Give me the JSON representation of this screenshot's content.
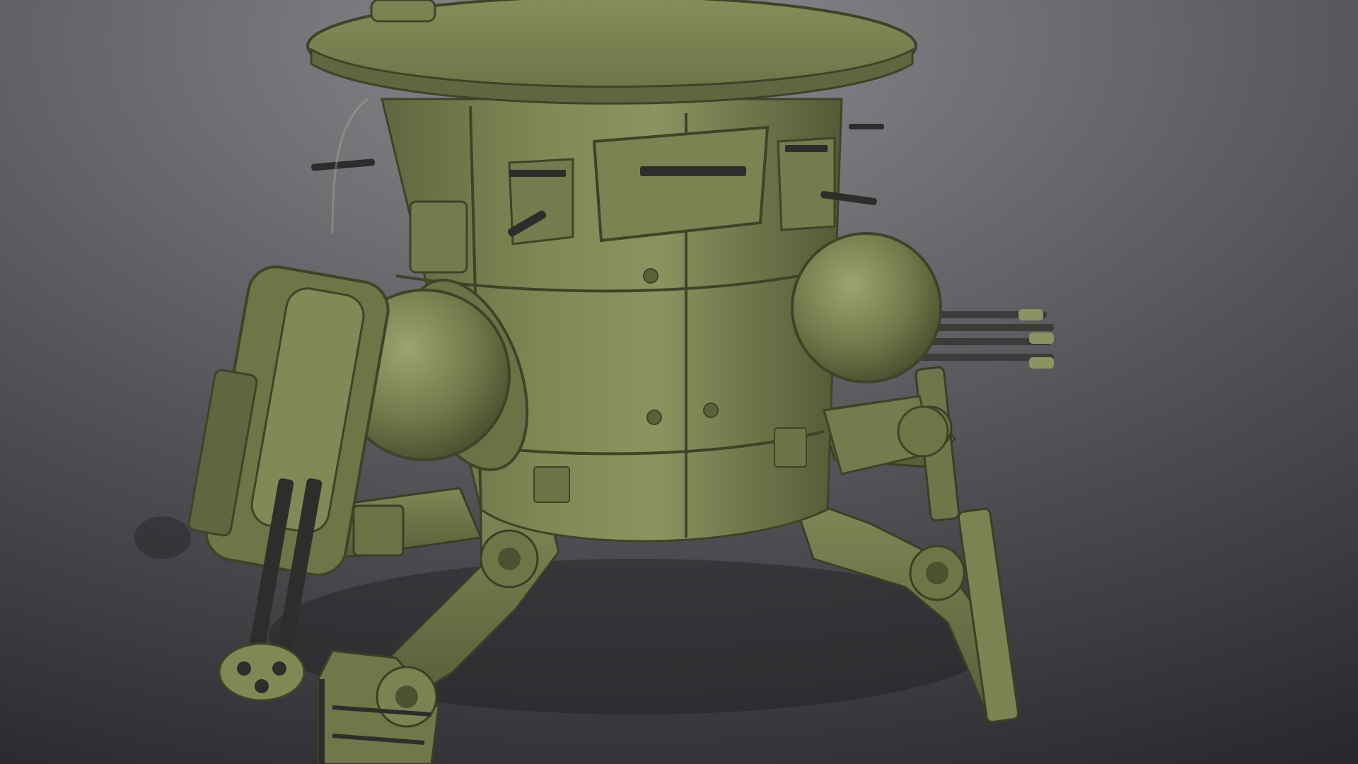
{
  "scene": {
    "subject": "olive-green-walker-mech-render",
    "colors": {
      "background_top": "#86888b",
      "background_bottom": "#2a2b2d",
      "armor_light": "#8a9460",
      "armor_mid": "#6e7749",
      "armor_dark": "#4b5232",
      "metal": "#2c2e2c",
      "highlight": "#b3b99a"
    },
    "icons": [
      "mech-body",
      "turret-hatch",
      "left-sphere-turret",
      "right-sphere-turret",
      "twin-barrel-gun",
      "multi-barrel-gun",
      "walker-legs"
    ]
  }
}
